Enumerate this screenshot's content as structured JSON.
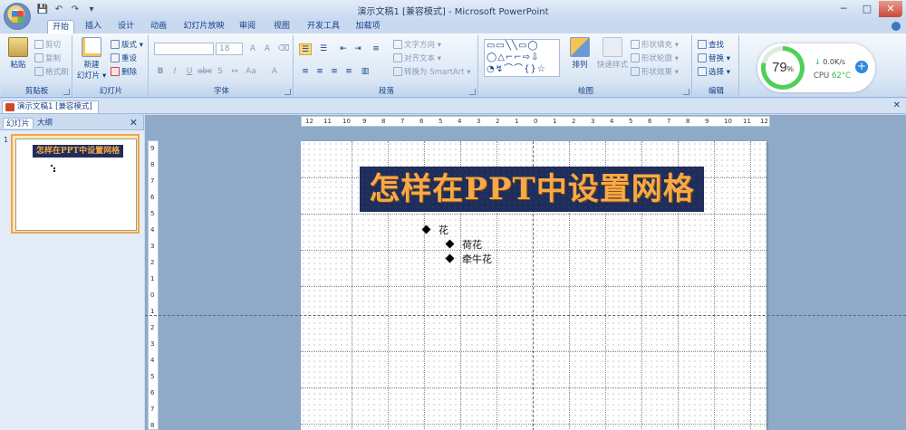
{
  "window": {
    "title": "演示文稿1 [兼容模式] - Microsoft PowerPoint",
    "minimize": "─",
    "maximize": "□",
    "close": "✕"
  },
  "qat": [
    "💾",
    "↶",
    "↷",
    "▾"
  ],
  "tabs": [
    {
      "label": "开始",
      "active": true
    },
    {
      "label": "插入"
    },
    {
      "label": "设计"
    },
    {
      "label": "动画"
    },
    {
      "label": "幻灯片放映"
    },
    {
      "label": "审阅"
    },
    {
      "label": "视图"
    },
    {
      "label": "开发工具"
    },
    {
      "label": "加载项"
    }
  ],
  "ribbon": {
    "clipboard": {
      "label": "剪贴板",
      "paste": "粘贴",
      "cut": "剪切",
      "copy": "复制",
      "format_painter": "格式刷"
    },
    "slides": {
      "label": "幻灯片",
      "new_slide": "新建",
      "new_slide2": "幻灯片 ▾",
      "layout": "版式 ▾",
      "reset": "重设",
      "delete": "删除"
    },
    "font": {
      "label": "字体",
      "size": "18"
    },
    "paragraph": {
      "label": "段落",
      "text_direction": "文字方向 ▾",
      "align_text": "对齐文本 ▾",
      "smartart": "转换为 SmartArt ▾"
    },
    "drawing": {
      "label": "绘图",
      "arrange": "排列",
      "quick_styles": "快速样式",
      "shape_fill": "形状填充 ▾",
      "shape_outline": "形状轮廓 ▾",
      "shape_effects": "形状效果 ▾"
    },
    "editing": {
      "label": "编辑",
      "find": "查找",
      "replace": "替换 ▾",
      "select": "选择 ▾"
    }
  },
  "widget": {
    "percent": "79",
    "unit": "%",
    "speed": "0.0K/s",
    "cpu_label": "CPU",
    "cpu_temp": "62°C",
    "plus": "+"
  },
  "document_tab": {
    "label": "演示文稿1 [兼容模式]",
    "close": "✕"
  },
  "left_panel": {
    "tab_slides": "幻灯片",
    "tab_outline": "大纲",
    "close": "✕",
    "slide_number": "1"
  },
  "slide": {
    "title": "怎样在PPT中设置网格",
    "bullets": [
      {
        "text": "花",
        "level": 1
      },
      {
        "text": "荷花",
        "level": 2
      },
      {
        "text": "牵牛花",
        "level": 2
      }
    ]
  },
  "ruler": {
    "h_ticks": [
      "12",
      "11",
      "10",
      "9",
      "8",
      "7",
      "6",
      "5",
      "4",
      "3",
      "2",
      "1",
      "0",
      "1",
      "2",
      "3",
      "4",
      "5",
      "6",
      "7",
      "8",
      "9",
      "10",
      "11",
      "12"
    ],
    "v_ticks": [
      "9",
      "8",
      "7",
      "6",
      "5",
      "4",
      "3",
      "2",
      "1",
      "0",
      "1",
      "2",
      "3",
      "4",
      "5",
      "6",
      "7",
      "8"
    ]
  },
  "colors": {
    "title_text": "#f7a946",
    "title_bg": "#1f2d5a",
    "ring": "#4fd05a"
  }
}
